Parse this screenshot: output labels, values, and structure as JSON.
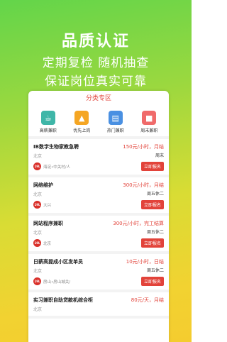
{
  "promo": {
    "title": "品质认证",
    "line1": "定期复检 随机抽查",
    "line2": "保证岗位真实可靠"
  },
  "section": {
    "title": "分类专区"
  },
  "categories": [
    {
      "label": "高薪兼职",
      "icon": "tea-icon",
      "color": "#3fb6a8"
    },
    {
      "label": "优先上岗",
      "icon": "rocket-icon",
      "color": "#f5a623"
    },
    {
      "label": "热门兼职",
      "icon": "clipboard-icon",
      "color": "#4a90e2"
    },
    {
      "label": "周末兼职",
      "icon": "gift-icon",
      "color": "#f06b6b"
    }
  ],
  "jobs": [
    {
      "title": "IB数学生物家教急聘",
      "pay": "150元/小时，月结",
      "location": "北京",
      "days": "周末",
      "company": "海淀•中关村/人",
      "apply": "立即报名"
    },
    {
      "title": "网络维护",
      "pay": "300元/小时，月结",
      "location": "北京",
      "days": "周五休二",
      "company": "大兴",
      "apply": "立即报名"
    },
    {
      "title": "网站程序兼职",
      "pay": "300元/小时，完工结算",
      "location": "北京",
      "days": "周五休二",
      "company": "北京",
      "apply": "立即报名"
    },
    {
      "title": "日薪高提成小区发单员",
      "pay": "10元/小时，日结",
      "location": "北京",
      "days": "周五休二",
      "company": "房山•房山城关/",
      "apply": "立即报名"
    },
    {
      "title": "实习兼职自助贷款机综合柜",
      "pay": "80元/天，月结",
      "location": "北京",
      "days": "",
      "company": "",
      "apply": ""
    }
  ]
}
